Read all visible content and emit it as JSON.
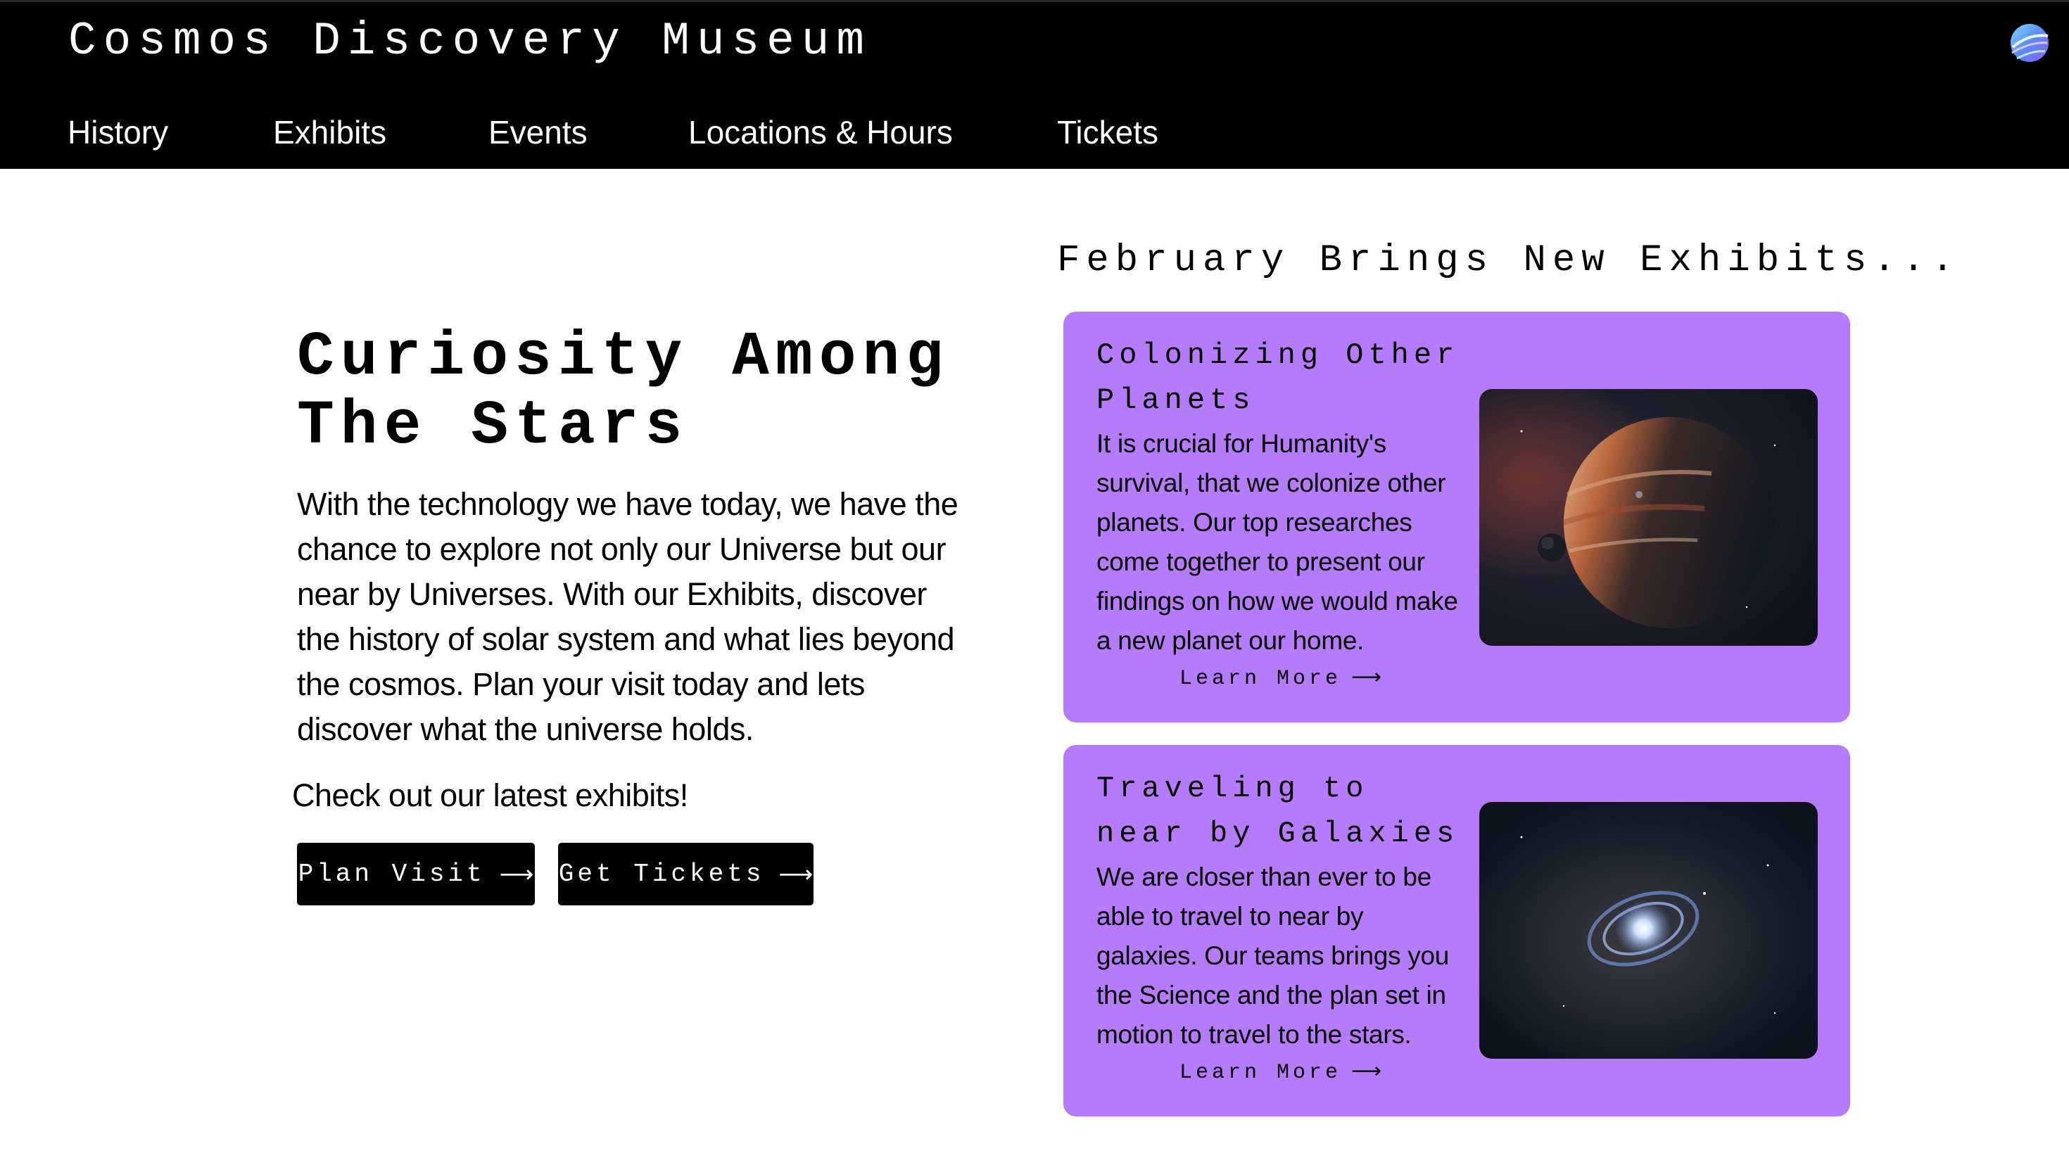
{
  "header": {
    "site_title": "Cosmos Discovery Museum",
    "logo_icon": "planet-logo-icon",
    "nav": [
      {
        "label": "History"
      },
      {
        "label": "Exhibits"
      },
      {
        "label": "Events"
      },
      {
        "label": "Locations & Hours"
      },
      {
        "label": "Tickets"
      }
    ]
  },
  "hero": {
    "title": "Curiosity Among The Stars",
    "body": "With the technology we have today, we have the chance to explore not only our Universe but our near by Universes. With our Exhibits, discover the history of solar system and what lies beyond the cosmos. Plan your visit today and lets discover what the universe holds.",
    "subheading": "Check out our latest exhibits!",
    "buttons": [
      {
        "label": "Plan Visit",
        "icon": "arrow-right-icon",
        "arrow": "⟶"
      },
      {
        "label": "Get Tickets",
        "icon": "arrow-right-icon",
        "arrow": "⟶"
      }
    ]
  },
  "exhibits": {
    "section_title": "February Brings New Exhibits...",
    "cards": [
      {
        "title": "Colonizing Other Planets",
        "body": "It is crucial for Humanity's survival, that we colonize other planets. Our top researches come together to present our findings on how we would make a new planet our home.",
        "link": "Learn More",
        "arrow": "⟶",
        "image": "gas-giant-planet-image"
      },
      {
        "title": "Traveling to near by Galaxies",
        "body": "We are closer than ever to be able to travel to near by galaxies. Our teams brings you the Science and the plan set in motion to travel to the stars.",
        "link": "Learn More",
        "arrow": "⟶",
        "image": "spiral-galaxy-image"
      }
    ]
  },
  "colors": {
    "header_bg": "#000000",
    "card_bg": "#b57bfa",
    "button_bg": "#000000",
    "text": "#000000"
  }
}
